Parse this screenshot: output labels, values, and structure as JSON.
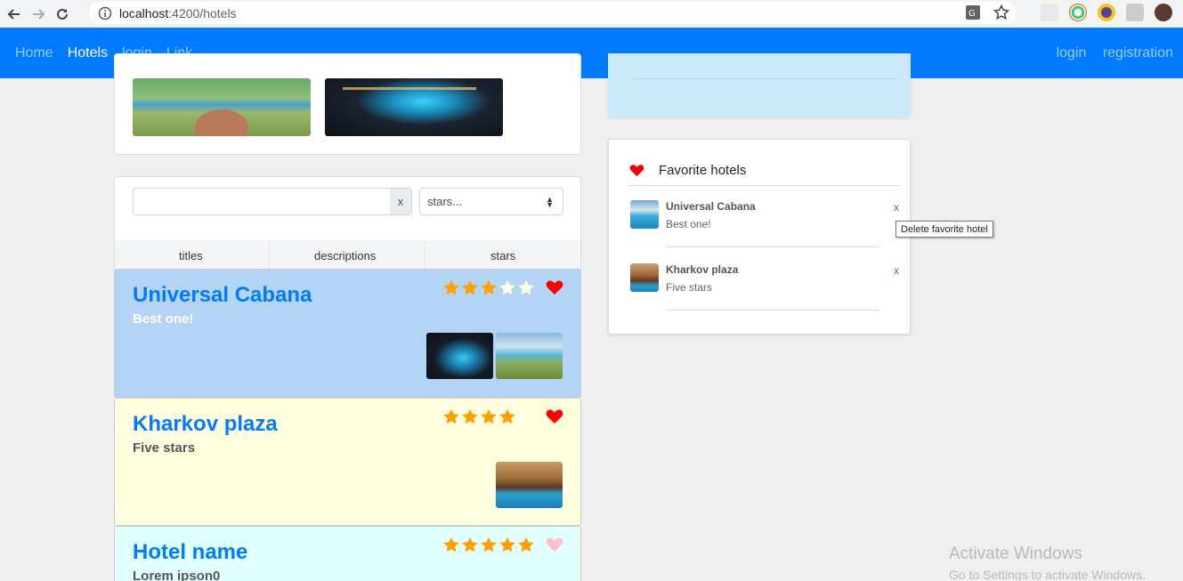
{
  "browser": {
    "url_host": "localhost",
    "url_path": ":4200/hotels"
  },
  "navbar": {
    "items": [
      {
        "label": "Home",
        "active": false
      },
      {
        "label": "Hotels",
        "active": true
      },
      {
        "label": "login",
        "active": false
      },
      {
        "label": "Link",
        "active": false
      }
    ],
    "right": {
      "login": "login",
      "registration": "registration"
    },
    "color": "#007bff"
  },
  "filter": {
    "search_value": "",
    "clear_label": "x",
    "stars_selected": "stars..."
  },
  "sort": {
    "titles": "titles",
    "descriptions": "descriptions",
    "stars": "stars"
  },
  "hotels": [
    {
      "name": "Universal Cabana",
      "description": "Best one!",
      "rating": 3,
      "favorite": true,
      "background": "#b3d4f5",
      "desc_color": "#ffffff"
    },
    {
      "name": "Kharkov plaza",
      "description": "Five stars",
      "rating": 4,
      "favorite": true,
      "background": "#ffffe0",
      "desc_color": "#555555"
    },
    {
      "name": "Hotel name",
      "description": "Lorem ipson0",
      "rating": 5,
      "favorite": false,
      "background": "#e0ffff",
      "desc_color": "#555555"
    }
  ],
  "favorites": {
    "title": "Favorite hotels",
    "items": [
      {
        "name": "Universal Cabana",
        "description": "Best one!",
        "delete": "x"
      },
      {
        "name": "Kharkov plaza",
        "description": "Five stars",
        "delete": "x"
      }
    ],
    "tooltip": "Delete favorite hotel"
  },
  "watermark": {
    "line1": "Activate Windows",
    "line2": "Go to Settings to activate Windows."
  }
}
